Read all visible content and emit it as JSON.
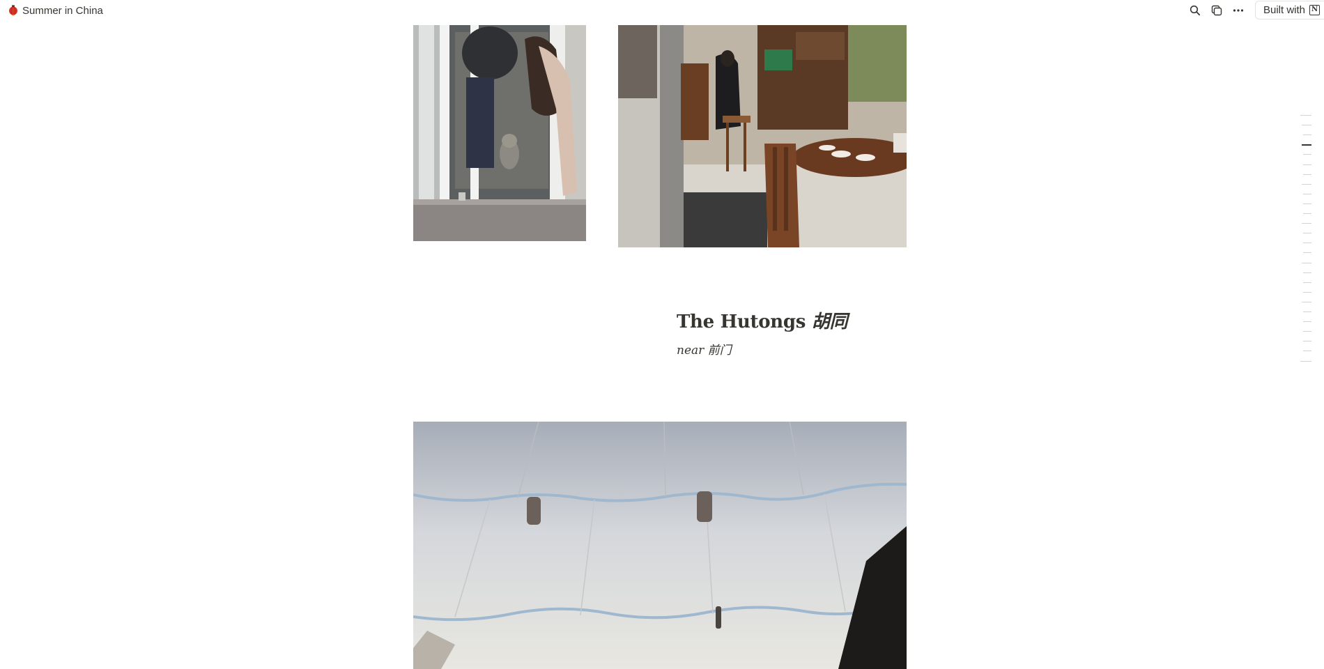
{
  "topbar": {
    "breadcrumb_icon": "red-lantern-emoji",
    "title": "Summer in China",
    "actions": [
      {
        "name": "search-icon"
      },
      {
        "name": "duplicate-icon"
      },
      {
        "name": "more-icon"
      }
    ],
    "built_with_label": "Built with",
    "built_with_logo": "N"
  },
  "content": {
    "section_title": "The Hutongs",
    "section_title_zh": "胡同",
    "section_subtitle": "near 前门",
    "images": [
      {
        "name": "photo-cat-at-door",
        "subject": "cat-behind-glass-door"
      },
      {
        "name": "photo-cafe-interior",
        "subject": "cafe-with-wooden-cabinet"
      },
      {
        "name": "photo-white-canopy",
        "subject": "fabric-canopy-ceiling"
      }
    ]
  },
  "toc": {
    "active_index": 3,
    "count": 26
  },
  "colors": {
    "text": "#37352f",
    "border": "#e3e2df",
    "toc_inactive": "#d3d2cf",
    "toc_active": "#37352f"
  }
}
